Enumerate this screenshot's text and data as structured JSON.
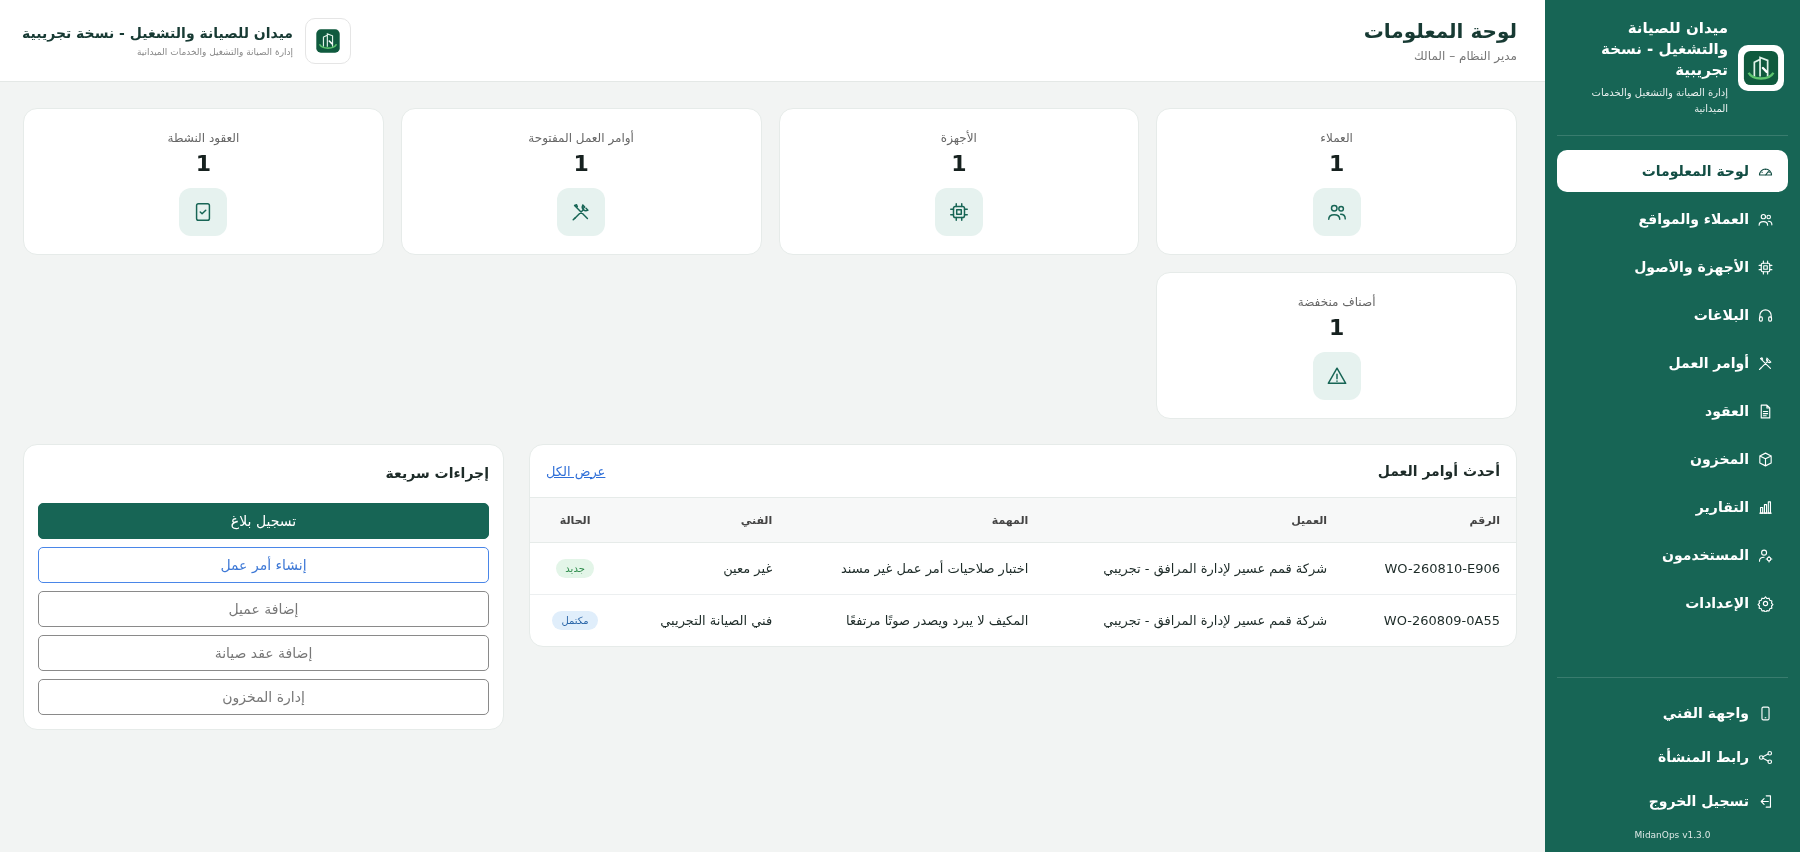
{
  "sidebar": {
    "brand": {
      "title": "ميدان للصيانة والتشغيل - نسخة تجريبية",
      "subtitle": "إدارة الصيانة والتشغيل والخدمات الميدانية"
    },
    "nav": [
      {
        "label": "لوحة المعلومات",
        "kind": "dashboard",
        "selected": true
      },
      {
        "label": "العملاء والمواقع",
        "kind": "clients",
        "selected": false
      },
      {
        "label": "الأجهزة والأصول",
        "kind": "devices",
        "selected": false
      },
      {
        "label": "البلاغات",
        "kind": "tickets",
        "selected": false
      },
      {
        "label": "أوامر العمل",
        "kind": "work_orders",
        "selected": false
      },
      {
        "label": "العقود",
        "kind": "contracts",
        "selected": false
      },
      {
        "label": "المخزون",
        "kind": "inventory",
        "selected": false
      },
      {
        "label": "التقارير",
        "kind": "reports",
        "selected": false
      },
      {
        "label": "المستخدمون",
        "kind": "users",
        "selected": false
      },
      {
        "label": "الإعدادات",
        "kind": "settings",
        "selected": false
      }
    ],
    "footer_nav": [
      {
        "label": "واجهة الفني",
        "kind": "mobile"
      },
      {
        "label": "رابط المنشأة",
        "kind": "share"
      },
      {
        "label": "تسجيل الخروج",
        "kind": "logout"
      }
    ],
    "version": "MidanOps v1.3.0"
  },
  "header": {
    "title": "لوحة المعلومات",
    "subtitle": "مدير النظام – المالك",
    "brand": {
      "title": "ميدان للصيانة والتشغيل - نسخة تجريبية",
      "subtitle": "إدارة الصيانة والتشغيل والخدمات الميدانية"
    }
  },
  "stats": [
    {
      "label": "العملاء",
      "value": "1",
      "kind": "clients"
    },
    {
      "label": "الأجهزة",
      "value": "1",
      "kind": "devices"
    },
    {
      "label": "أوامر العمل المفتوحة",
      "value": "1",
      "kind": "work_orders"
    },
    {
      "label": "العقود النشطة",
      "value": "1",
      "kind": "active_contracts"
    },
    {
      "label": "أصناف منخفضة",
      "value": "1",
      "kind": "low_stock"
    }
  ],
  "recent_work_orders": {
    "title": "أحدث أوامر العمل",
    "view_all": "عرض الكل",
    "columns": [
      "الرقم",
      "العميل",
      "المهمة",
      "الفني",
      "الحالة"
    ],
    "rows": [
      {
        "number": "WO-260810-E906",
        "client": "شركة قمم عسير لإدارة المرافق - تجريبي",
        "task": "اختبار صلاحيات أمر عمل غير مسند",
        "technician": "غير معين",
        "status": {
          "label": "جديد",
          "kind": "new"
        }
      },
      {
        "number": "WO-260809-0A55",
        "client": "شركة قمم عسير لإدارة المرافق - تجريبي",
        "task": "المكيف لا يبرد ويصدر صوتًا مرتفعًا",
        "technician": "فني الصيانة التجريبي",
        "status": {
          "label": "مكتمل",
          "kind": "completed"
        }
      }
    ]
  },
  "quick_actions": {
    "title": "إجراءات سريعة",
    "buttons": [
      {
        "label": "تسجيل بلاغ",
        "kind": "primary"
      },
      {
        "label": "إنشاء أمر عمل",
        "kind": "focused"
      },
      {
        "label": "إضافة عميل",
        "kind": "outline"
      },
      {
        "label": "إضافة عقد صيانة",
        "kind": "outline"
      },
      {
        "label": "إدارة المخزون",
        "kind": "outline"
      }
    ]
  }
}
